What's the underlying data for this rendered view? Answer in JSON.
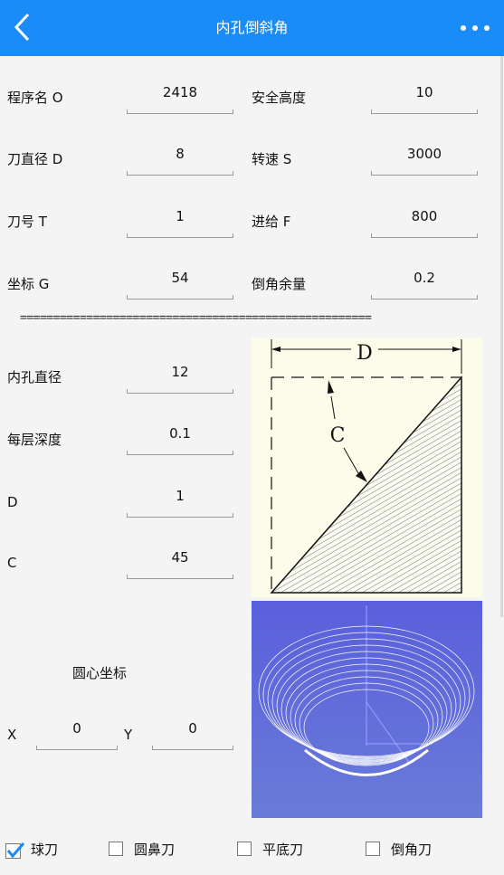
{
  "header": {
    "title": "内孔倒斜角",
    "back_icon": "chevron-left-icon",
    "more_icon": "more-horizontal-icon",
    "bg_color": "#1a8cf7"
  },
  "params": {
    "program_name": {
      "label": "程序名 O",
      "value": "2418"
    },
    "safe_height": {
      "label": "安全高度",
      "value": "10"
    },
    "tool_diameter": {
      "label": "刀直径 D",
      "value": "8"
    },
    "spindle_speed": {
      "label": "转速 S",
      "value": "3000"
    },
    "tool_number": {
      "label": "刀号 T",
      "value": "1"
    },
    "feed": {
      "label": "进给 F",
      "value": "800"
    },
    "coordinate": {
      "label": "坐标 G",
      "value": "54"
    },
    "chamfer_allowance": {
      "label": "倒角余量",
      "value": "0.2"
    }
  },
  "separator": "=====================================================",
  "hole": {
    "inner_diameter": {
      "label": "内孔直径",
      "value": "12"
    },
    "layer_depth": {
      "label": "每层深度",
      "value": "0.1"
    },
    "d": {
      "label": "D",
      "value": "1"
    },
    "c": {
      "label": "C",
      "value": "45"
    }
  },
  "center": {
    "title": "圆心坐标",
    "x": {
      "label": "X",
      "value": "0"
    },
    "y": {
      "label": "Y",
      "value": "0"
    }
  },
  "diagram": {
    "label_d": "D",
    "label_c": "C"
  },
  "tools": [
    {
      "label": "球刀",
      "checked": true
    },
    {
      "label": "圆鼻刀",
      "checked": false
    },
    {
      "label": "平底刀",
      "checked": false
    },
    {
      "label": "倒角刀",
      "checked": false
    }
  ]
}
